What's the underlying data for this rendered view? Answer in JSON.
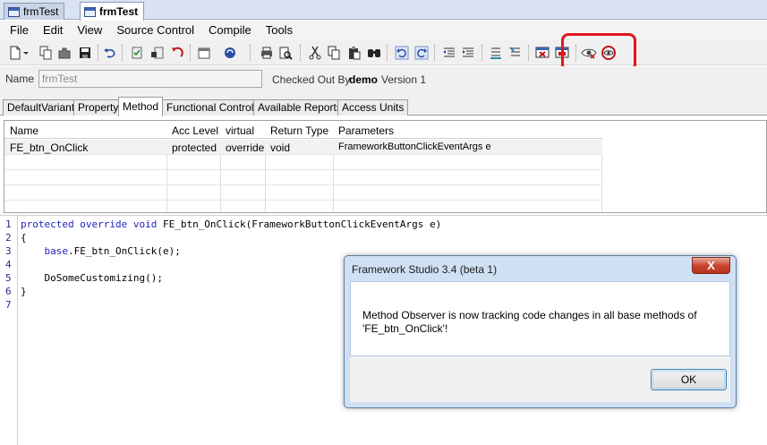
{
  "doc_tabs": [
    {
      "label": "frmTest",
      "active": false
    },
    {
      "label": "frmTest",
      "active": true
    }
  ],
  "menu": [
    "File",
    "Edit",
    "View",
    "Source Control",
    "Compile",
    "Tools"
  ],
  "toolbar_icons": [
    "new-file-icon",
    "dropdown-arrow-icon",
    "copy-document-icon",
    "plugin-icon",
    "save-icon",
    "undo-icon",
    "checkin-icon",
    "checkout-icon",
    "revert-icon",
    "calendar-icon",
    "refresh-icon",
    "print-icon",
    "print-preview-icon",
    "cut-icon",
    "copy-icon",
    "paste-icon",
    "find-icon",
    "undo-blue-icon",
    "redo-blue-icon",
    "outdent-icon",
    "indent-icon",
    "comment-icon",
    "uncomment-icon",
    "delete-form-icon",
    "form-icon",
    "method-observer-eye-icon",
    "method-observer-refresh-icon"
  ],
  "name_row": {
    "name_label": "Name",
    "name_value": "frmTest",
    "checked_out_label": "Checked Out By",
    "checked_out_user": "demo",
    "version_label": "Version 1"
  },
  "property_tabs": [
    "DefaultVariant",
    "Property",
    "Method",
    "Functional Controls",
    "Available Reports",
    "Access Units"
  ],
  "active_property_tab": "Method",
  "grid": {
    "columns": [
      "Name",
      "Acc Level",
      "virtual",
      "Return Type",
      "Parameters"
    ],
    "rows": [
      [
        "FE_btn_OnClick",
        "protected",
        "override",
        "void",
        "FrameworkButtonClickEventArgs e"
      ]
    ]
  },
  "code": {
    "line_numbers": [
      "1",
      "2",
      "3",
      "4",
      "5",
      "6",
      "7"
    ],
    "lines": [
      {
        "kw": "protected override void ",
        "text": "FE_btn_OnClick(FrameworkButtonClickEventArgs e)"
      },
      {
        "kw": "",
        "text": "{"
      },
      {
        "kw": "    base",
        "text": ".FE_btn_OnClick(e);"
      },
      {
        "kw": "",
        "text": ""
      },
      {
        "kw": "",
        "text": "    DoSomeCustomizing();"
      },
      {
        "kw": "",
        "text": "}"
      },
      {
        "kw": "",
        "text": ""
      }
    ]
  },
  "dialog": {
    "title": "Framework Studio 3.4 (beta 1)",
    "close": "X",
    "message": "Method Observer is now tracking code changes in all base methods of 'FE_btn_OnClick'!",
    "ok_label": "OK"
  },
  "colors": {
    "highlight": "#e4161b",
    "keyword": "#1f1fbf",
    "dialog_frame": "#cfe0f3"
  }
}
